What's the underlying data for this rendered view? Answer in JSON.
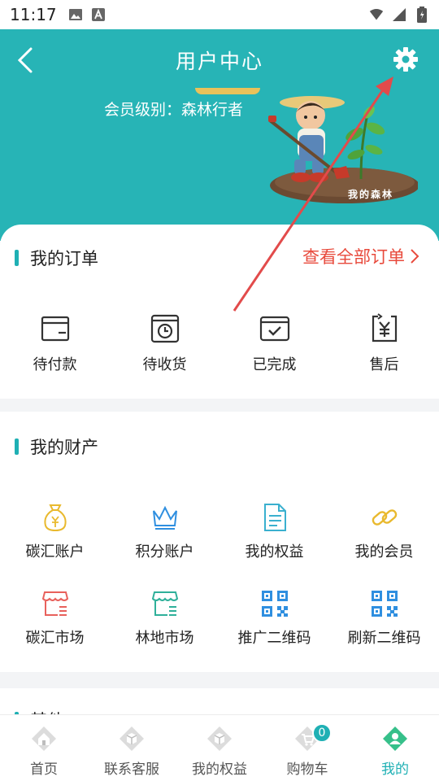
{
  "status_bar": {
    "time": "11:17"
  },
  "header": {
    "title": "用户中心",
    "member_level": "会员级别：森林行者",
    "forest_caption": "我的森林",
    "bg_color": "#27b4b6"
  },
  "orders": {
    "title": "我的订单",
    "view_all": "查看全部订单",
    "items": [
      {
        "label": "待付款",
        "icon": "wallet-icon"
      },
      {
        "label": "待收货",
        "icon": "clock-box-icon"
      },
      {
        "label": "已完成",
        "icon": "checked-box-icon"
      },
      {
        "label": "售后",
        "icon": "yuan-return-icon"
      }
    ]
  },
  "assets": {
    "title": "我的财产",
    "items": [
      {
        "label": "碳汇账户",
        "icon": "money-bag-icon"
      },
      {
        "label": "积分账户",
        "icon": "crown-icon"
      },
      {
        "label": "我的权益",
        "icon": "document-icon"
      },
      {
        "label": "我的会员",
        "icon": "link-icon"
      },
      {
        "label": "碳汇市场",
        "icon": "store-icon"
      },
      {
        "label": "林地市场",
        "icon": "store-icon"
      },
      {
        "label": "推广二维码",
        "icon": "qr-code-icon"
      },
      {
        "label": "刷新二维码",
        "icon": "qr-code-icon"
      }
    ]
  },
  "other": {
    "title": "其他"
  },
  "bottom_nav": {
    "items": [
      {
        "label": "首页",
        "icon": "home-icon"
      },
      {
        "label": "联系客服",
        "icon": "service-icon"
      },
      {
        "label": "我的权益",
        "icon": "rights-icon"
      },
      {
        "label": "购物车",
        "icon": "cart-icon",
        "badge": "0"
      },
      {
        "label": "我的",
        "icon": "user-icon",
        "active": true
      }
    ]
  },
  "colors": {
    "accent": "#1fb0b4",
    "link_red": "#e84a3c",
    "gold": "#e9b92e",
    "icon_blue": "#2f8fe0"
  }
}
